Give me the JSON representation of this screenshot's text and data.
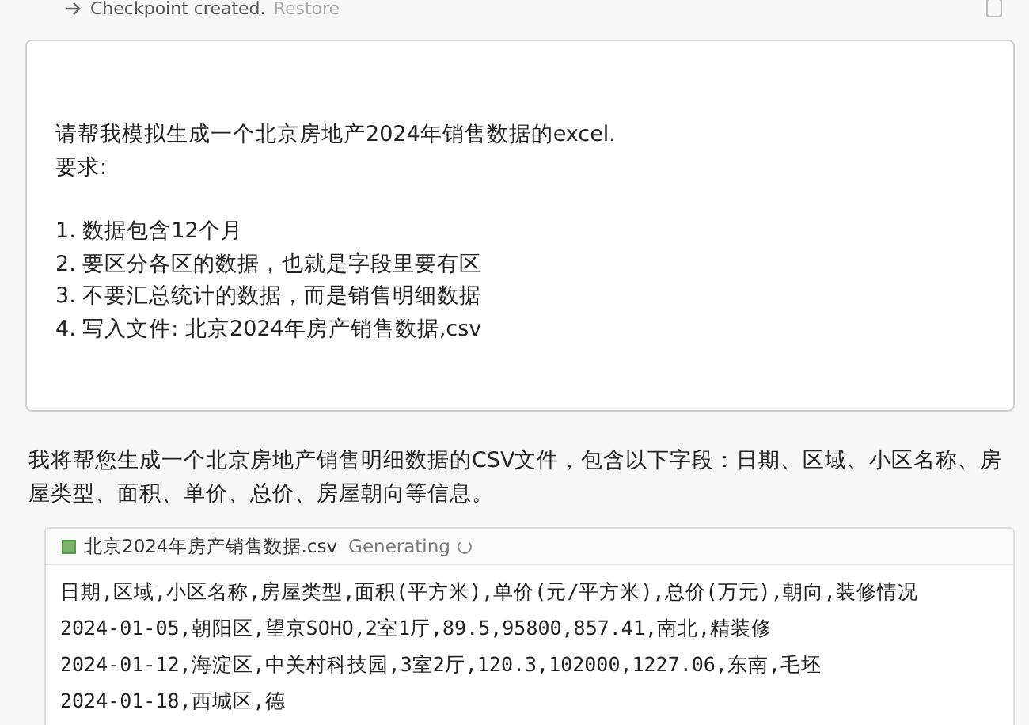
{
  "checkpoint": {
    "label": "Checkpoint created.",
    "action": "Restore"
  },
  "prompt": {
    "intro": [
      "请帮我模拟生成一个北京房地产2024年销售数据的excel.",
      "要求:"
    ],
    "requirements": [
      "1. 数据包含12个月",
      "2. 要区分各区的数据，也就是字段里要有区",
      "3. 不要汇总统计的数据，而是销售明细数据",
      "4. 写入文件: 北京2024年房产销售数据,csv"
    ]
  },
  "response": "我将帮您生成一个北京房地产销售明细数据的CSV文件，包含以下字段：日期、区域、小区名称、房屋类型、面积、单价、总价、房屋朝向等信息。",
  "file": {
    "name": "北京2024年房产销售数据.csv",
    "status": "Generating",
    "generating": true,
    "lines": [
      "日期,区域,小区名称,房屋类型,面积(平方米),单价(元/平方米),总价(万元),朝向,装修情况",
      "2024-01-05,朝阳区,望京SOHO,2室1厅,89.5,95800,857.41,南北,精装修",
      "2024-01-12,海淀区,中关村科技园,3室2厅,120.3,102000,1227.06,东南,毛坯",
      "2024-01-18,西城区,德"
    ]
  }
}
